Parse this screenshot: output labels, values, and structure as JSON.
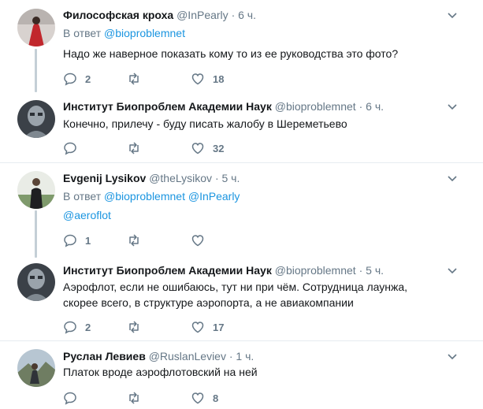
{
  "tweets": [
    {
      "name": "Философская кроха",
      "handle": "@InPearly",
      "dot": "·",
      "time": "6 ч.",
      "reply_prefix": "В ответ",
      "reply_to": "@bioproblemnet",
      "reply_to_2": "",
      "text": "Надо же наверное показать кому то из ее руководства это фото?",
      "replies": "2",
      "retweets": "",
      "likes": "18"
    },
    {
      "name": "Институт Биопроблем Академии Наук",
      "handle": "@bioproblemnet",
      "dot": "·",
      "time": "6 ч.",
      "text": "Конечно, прилечу - буду писать жалобу в Шереметьево",
      "replies": "",
      "retweets": "",
      "likes": "32"
    },
    {
      "name": "Evgenij Lysikov",
      "handle": "@theLysikov",
      "dot": "·",
      "time": "5 ч.",
      "reply_prefix": "В ответ",
      "reply_to": "@bioproblemnet",
      "reply_to_2": "@InPearly",
      "text": "@aeroflot",
      "replies": "1",
      "retweets": "",
      "likes": ""
    },
    {
      "name": "Институт Биопроблем Академии Наук",
      "handle": "@bioproblemnet",
      "dot": "·",
      "time": "5 ч.",
      "text": "Аэрофлот, если не ошибаюсь, тут ни при чём. Сотрудница лаунжа, скорее всего, в структуре аэропорта, а не авиакомпании",
      "replies": "2",
      "retweets": "",
      "likes": "17"
    },
    {
      "name": "Руслан Левиев",
      "handle": "@RuslanLeviev",
      "dot": "·",
      "time": "1 ч.",
      "text": "Платок вроде аэрофлотовский на ней",
      "replies": "",
      "retweets": "",
      "likes": "8"
    }
  ],
  "colors": {
    "accent": "#1b95e0",
    "muted": "#657786",
    "divider": "#e6ecf0",
    "thread_line": "#c4cfd6"
  },
  "icons": [
    "reply-icon",
    "retweet-icon",
    "like-icon",
    "chevron-down-icon"
  ]
}
